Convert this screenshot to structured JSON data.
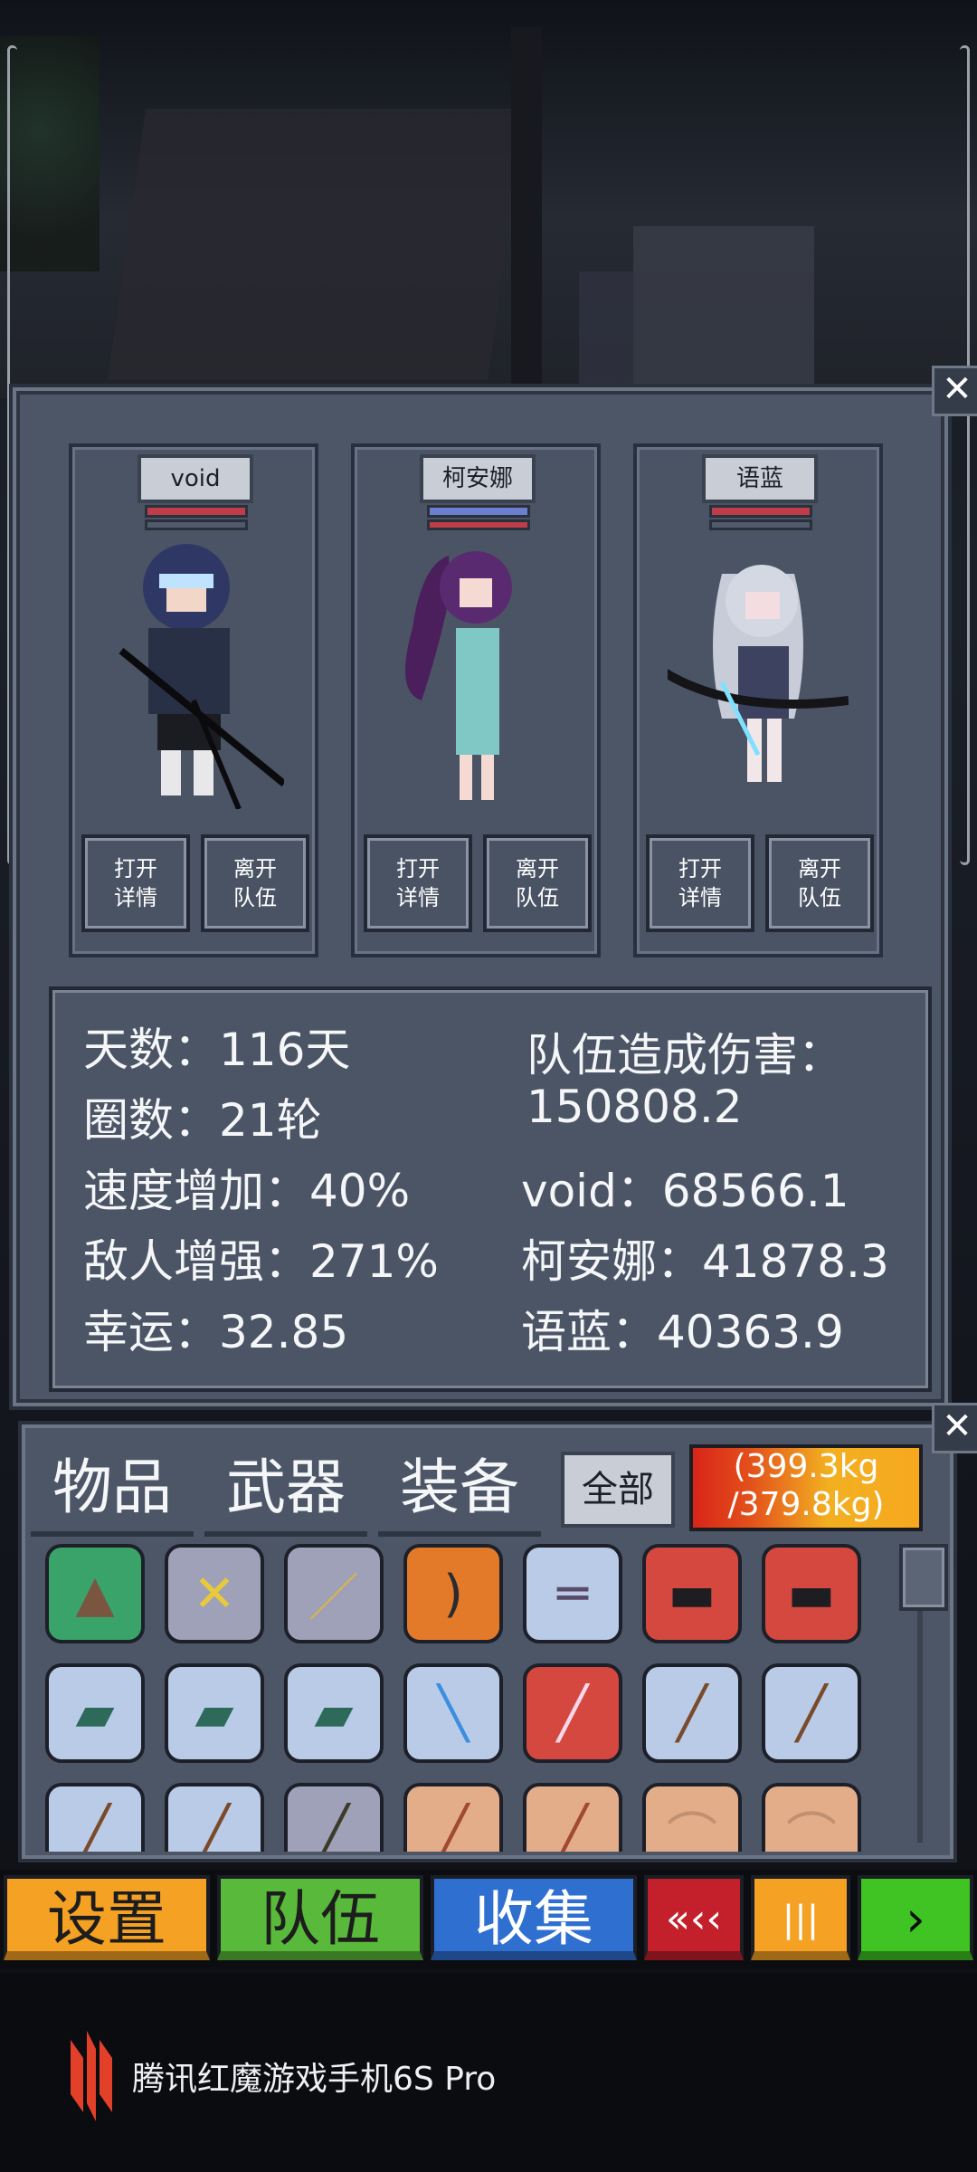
{
  "cards": [
    {
      "name": "void",
      "btn_details": [
        "打开",
        "详情"
      ],
      "btn_leave": [
        "离开",
        "队伍"
      ]
    },
    {
      "name": "柯安娜",
      "btn_details": [
        "打开",
        "详情"
      ],
      "btn_leave": [
        "离开",
        "队伍"
      ]
    },
    {
      "name": "语蓝",
      "btn_details": [
        "打开",
        "详情"
      ],
      "btn_leave": [
        "离开",
        "队伍"
      ]
    }
  ],
  "stats": {
    "days": "天数：116天",
    "laps": "圈数：21轮",
    "speed": "速度增加：40%",
    "enemy": "敌人增强：271%",
    "luck": "幸运：32.85",
    "team_damage_label": "队伍造成伤害：",
    "team_damage_value": "150808.2",
    "void_damage": "void：68566.1",
    "keanna_damage": "柯安娜：41878.3",
    "yulan_damage": "语蓝：40363.9"
  },
  "inventory": {
    "tabs": [
      "物品",
      "武器",
      "装备"
    ],
    "filter_label": "全部",
    "weight_line1": "(399.3kg",
    "weight_line2": "/379.8kg)"
  },
  "bottom_bar": {
    "settings": "设置",
    "team": "队伍",
    "collect": "收集",
    "rewind": "«‹‹",
    "pause": "|||",
    "play": "›"
  },
  "brand": {
    "text": "腾讯红魔游戏手机6S Pro"
  },
  "colors": {
    "orange": "#f5a124",
    "green": "#58b93a",
    "blue": "#2f6fd0",
    "red": "#c4202c",
    "bright_green": "#3fc423"
  }
}
